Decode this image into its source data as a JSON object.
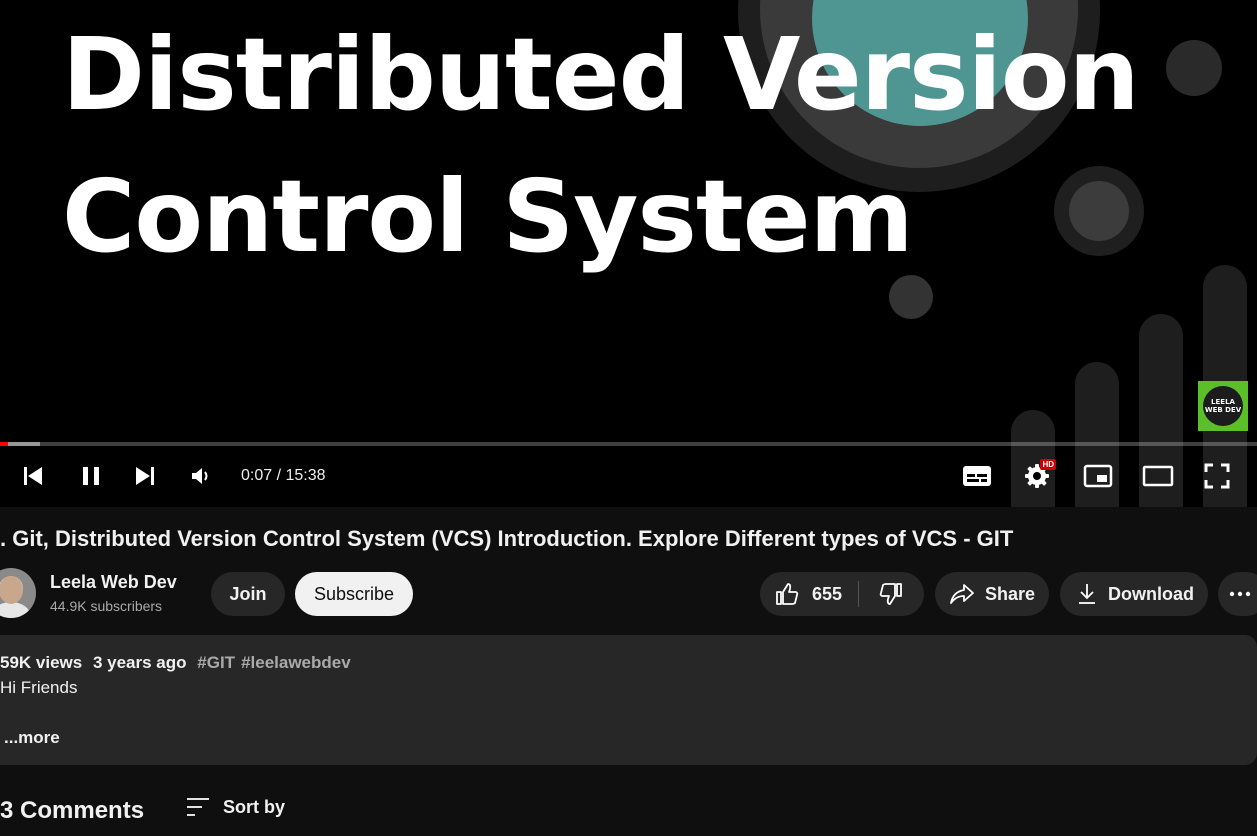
{
  "player": {
    "video_title_line1": "Distributed Version",
    "video_title_line2": "Control System",
    "watermark_text": "LEELA WEB DEV",
    "time": "0:07 / 15:38",
    "progress_played_fraction": 0.006,
    "progress_buffered_fraction": 0.032,
    "hd_badge": "HD",
    "controls": {
      "previous_icon": "skip-previous-icon",
      "pause_icon": "pause-icon",
      "next_icon": "skip-next-icon",
      "volume_icon": "volume-icon",
      "subtitles_icon": "subtitles-icon",
      "settings_icon": "gear-icon",
      "miniplayer_icon": "miniplayer-icon",
      "theater_icon": "theater-mode-icon",
      "fullscreen_icon": "fullscreen-icon"
    },
    "colors": {
      "progress": "#ff0000",
      "teal": "#4f9692",
      "watermark": "#5bbf2a"
    }
  },
  "video": {
    "title": ". Git, Distributed Version Control System (VCS) Introduction. Explore Different types of VCS - GIT"
  },
  "channel": {
    "name": "Leela Web Dev",
    "subscribers": "44.9K subscribers",
    "join_label": "Join",
    "subscribe_label": "Subscribe"
  },
  "actions": {
    "like_count": "655",
    "share_label": "Share",
    "download_label": "Download"
  },
  "description": {
    "views": "59K views",
    "age": "3 years ago",
    "tags": [
      "#GIT",
      "#leelawebdev"
    ],
    "text": "Hi Friends",
    "more_label": "...more"
  },
  "comments": {
    "count_label": "3 Comments",
    "sort_label": "Sort by"
  }
}
